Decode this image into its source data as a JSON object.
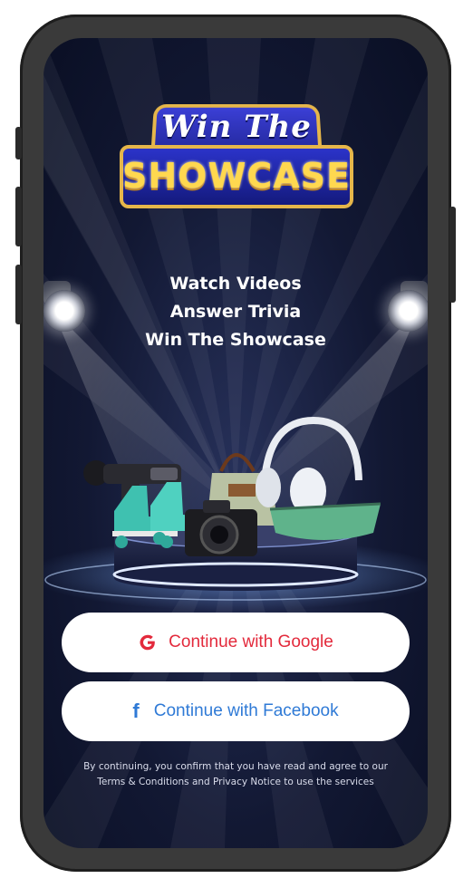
{
  "logo": {
    "line1": "Win The",
    "line2": "SHOWCASE"
  },
  "tagline": {
    "lines": [
      "Watch Videos",
      "Answer Trivia",
      "Win The Showcase"
    ]
  },
  "prizes": [
    "massage-gun",
    "roller-skates",
    "handbag",
    "headphones",
    "camera",
    "canoe"
  ],
  "buttons": {
    "google_label": "Continue with Google",
    "facebook_label": "Continue with Facebook"
  },
  "legal": {
    "line1": "By continuing, you confirm that you have read and agree to our",
    "line2": "Terms & Conditions and Privacy Notice to use the services"
  },
  "colors": {
    "background": "#121833",
    "accent_gold": "#e6b64a",
    "google_red": "#e32a3c",
    "facebook_blue": "#2f7ad6",
    "button_bg": "#ffffff"
  }
}
